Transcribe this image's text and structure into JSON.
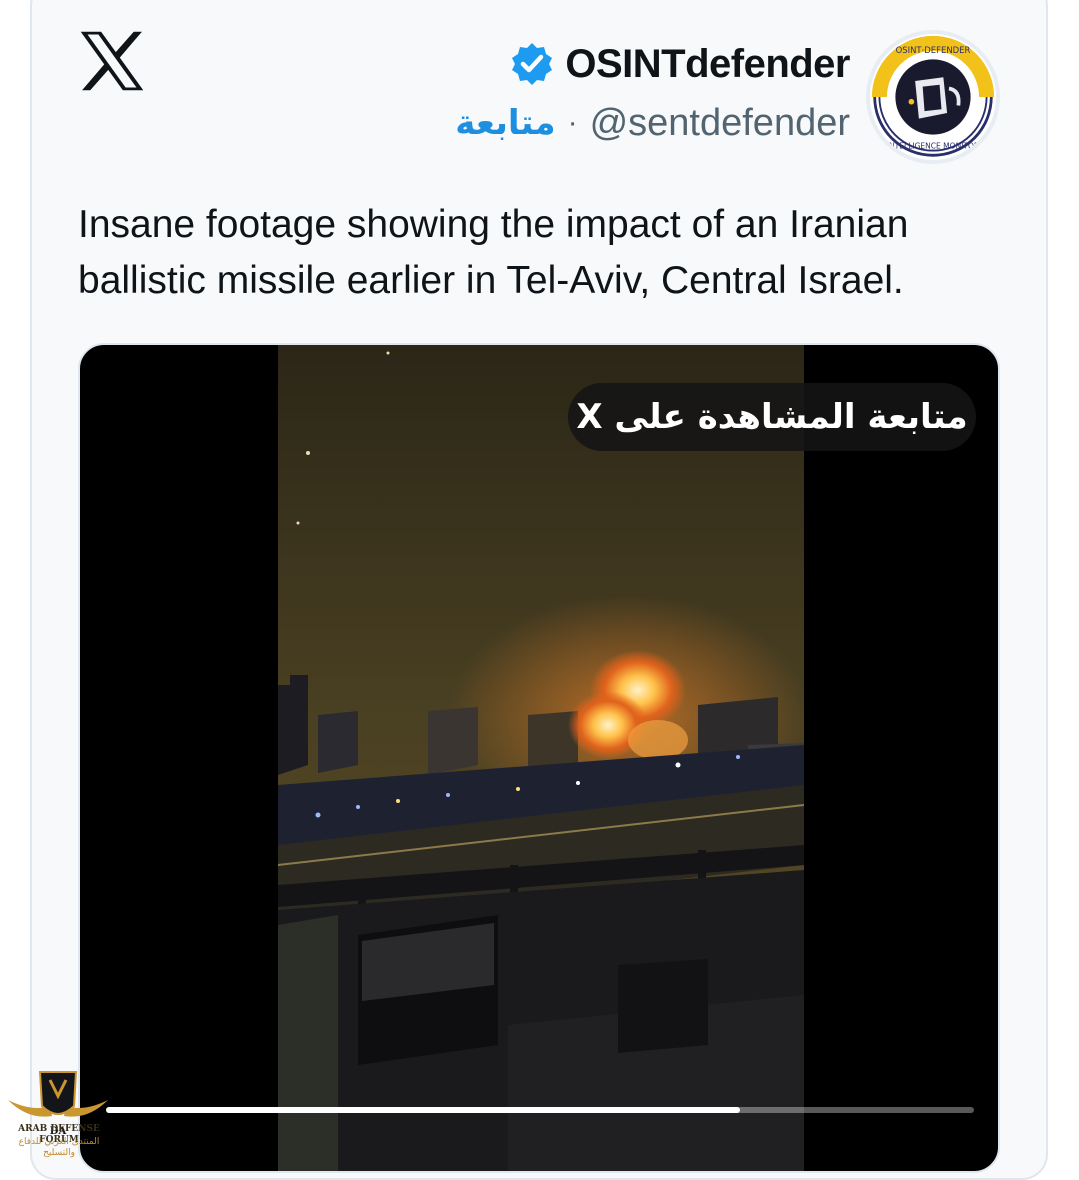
{
  "post": {
    "display_name": "OSINTdefender",
    "handle": "@sentdefender",
    "separator": "·",
    "follow_label": "متابعة",
    "verified": true,
    "text": "Insane footage showing the impact of an Iranian ballistic missile earlier in Tel-Aviv, Central Israel.",
    "avatar_icon": "osint-defender-logo"
  },
  "media": {
    "watch_label": "متابعة المشاهدة على X",
    "progress": 0.73
  },
  "brand": {
    "x_icon": "x-logo-icon",
    "accent": "#1d9bf0",
    "verified_color": "#1d9bf0"
  },
  "watermark": {
    "line1": "ARAB DEFENSE FORUM",
    "line2": "المنتدى العربي للدفاع والتسليح"
  }
}
